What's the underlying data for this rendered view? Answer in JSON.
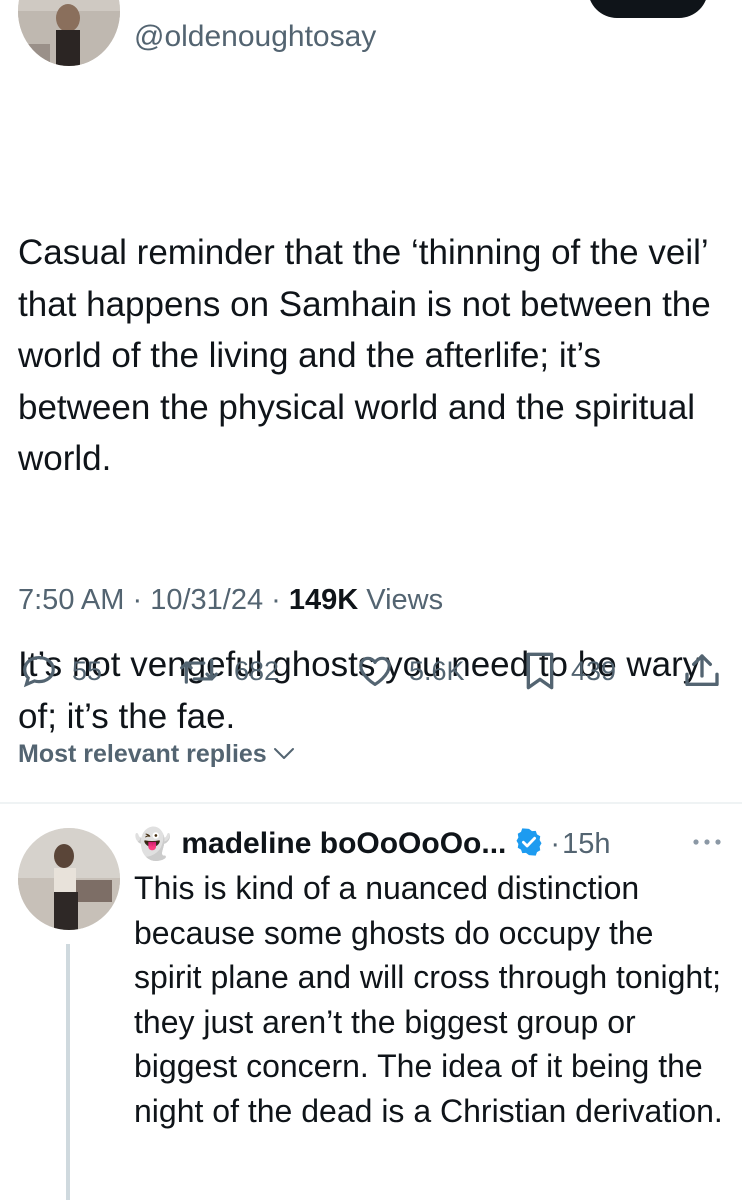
{
  "tweet": {
    "handle": "@oldenoughtosay",
    "paragraphs": [
      "Casual reminder that the ‘thinning of the veil’ that happens on Samhain is not between the world of the living and the afterlife; it’s between the physical world and the spiritual world.",
      "It’s not vengeful ghosts you need to be wary of; it’s the fae."
    ],
    "time": "7:50 AM",
    "date": "10/31/24",
    "sep": "·",
    "views_count": "149K",
    "views_label": "Views"
  },
  "actions": {
    "replies": "55",
    "reposts": "682",
    "likes": "5.6K",
    "bookmarks": "439"
  },
  "sort": {
    "label": "Most relevant replies"
  },
  "reply": {
    "name_emoji": "👻",
    "name": "madeline boOoOoOo...",
    "sep": "·",
    "time": "15h",
    "text": "This is kind of a nuanced distinction because some ghosts do occupy the spirit plane and will cross through tonight; they just aren’t the biggest group or biggest concern. The idea of it being the night of the dead is a Christian derivation."
  },
  "colors": {
    "text_primary": "#0f1419",
    "text_secondary": "#536471",
    "verified_blue": "#1d9bf0",
    "divider": "#eff3f4"
  },
  "icons": {
    "reply": "reply-icon",
    "repost": "repost-icon",
    "like": "heart-icon",
    "bookmark": "bookmark-icon",
    "share": "share-icon",
    "verified": "verified-badge-icon",
    "more": "more-horizontal-icon",
    "sort": "chevron-down-icon"
  }
}
